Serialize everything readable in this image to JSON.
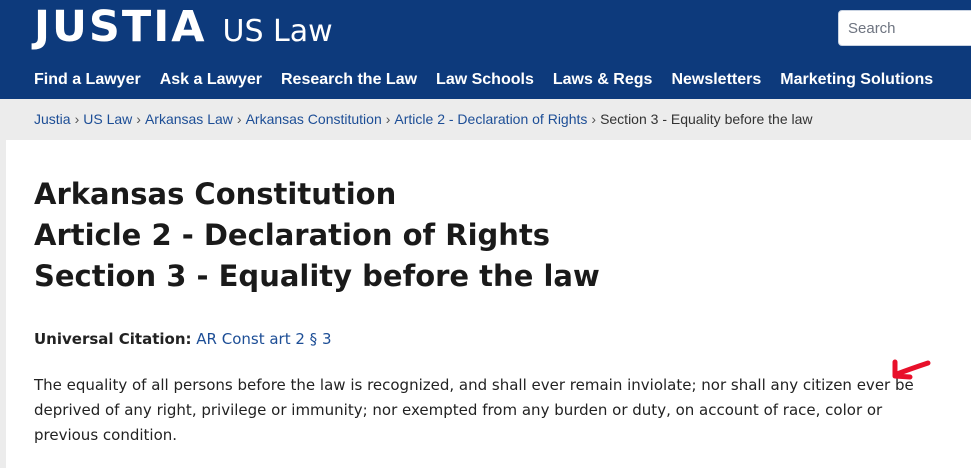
{
  "header": {
    "logo_main": "JUSTIA",
    "logo_sub": "US Law",
    "search_placeholder": "Search",
    "bg_color": "#0d3a7c"
  },
  "nav": {
    "items": [
      "Find a Lawyer",
      "Ask a Lawyer",
      "Research the Law",
      "Law Schools",
      "Laws & Regs",
      "Newsletters",
      "Marketing Solutions"
    ]
  },
  "breadcrumb": {
    "links": [
      "Justia",
      "US Law",
      "Arkansas Law",
      "Arkansas Constitution",
      "Article 2 - Declaration of Rights"
    ],
    "separator": "›",
    "current": "Section 3 - Equality before the law"
  },
  "page": {
    "title_lines": [
      "Arkansas Constitution",
      "Article 2 - Declaration of Rights",
      "Section 3 - Equality before the law"
    ],
    "citation_label": "Universal Citation:",
    "citation_link": "AR Const art 2 § 3",
    "body": "The equality of all persons before the law is recognized, and shall ever remain inviolate; nor shall any citizen ever be deprived of any right, privilege or immunity; nor exempted from any burden or duty, on account of race, color or previous condition."
  },
  "annotation": {
    "icon": "red-arrow-icon",
    "color": "#e8102a"
  }
}
